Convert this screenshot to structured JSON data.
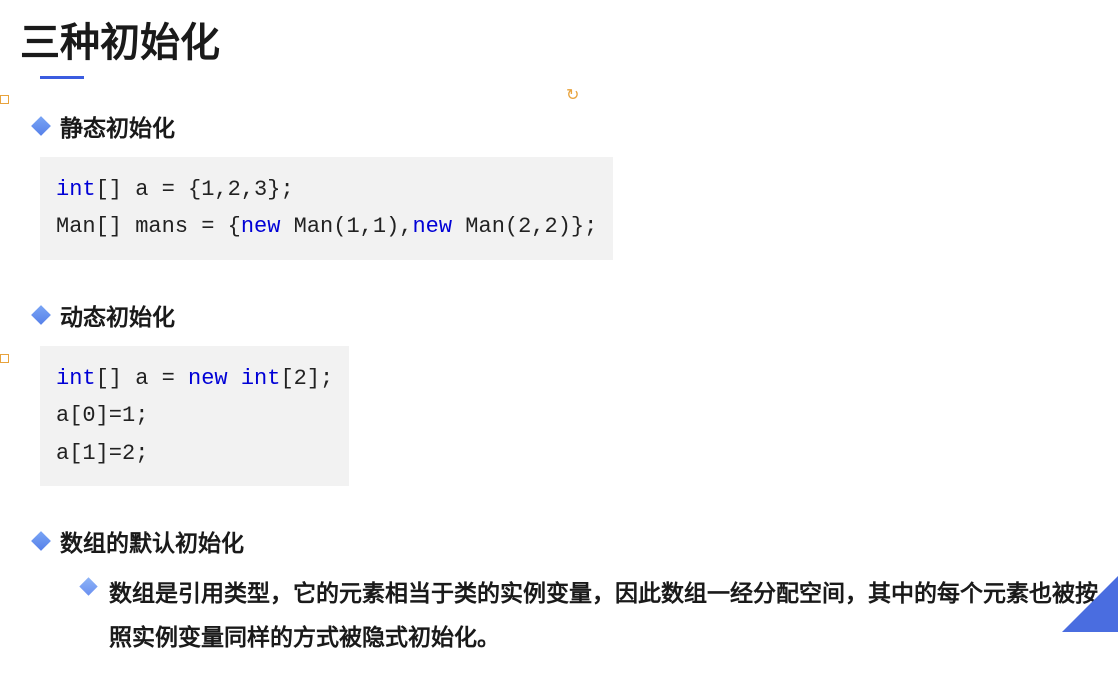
{
  "title": "三种初始化",
  "sections": [
    {
      "heading": "静态初始化",
      "code": {
        "line1": {
          "kw1": "int",
          "rest1": "[] a = {",
          "nums": "1,2,3",
          "rest2": "};"
        },
        "line2": {
          "t1": "Man[] mans = {",
          "kw2": "new",
          "t2": " Man(",
          "n1": "1,1",
          "t3": "),",
          "kw3": "new",
          "t4": " Man(",
          "n2": "2,2",
          "t5": ")};"
        }
      }
    },
    {
      "heading": "动态初始化",
      "code": {
        "line1": {
          "kw1": "int",
          "t1": "[] a = ",
          "kw2": "new",
          "t2": " ",
          "kw3": "int",
          "t3": "[",
          "n": "2",
          "t4": "];"
        },
        "line2": "a[0]=1;",
        "line3": "a[1]=2;"
      }
    },
    {
      "heading": "数组的默认初始化",
      "subtext": "数组是引用类型，它的元素相当于类的实例变量，因此数组一经分配空间，其中的每个元素也被按照实例变量同样的方式被隐式初始化。"
    }
  ]
}
